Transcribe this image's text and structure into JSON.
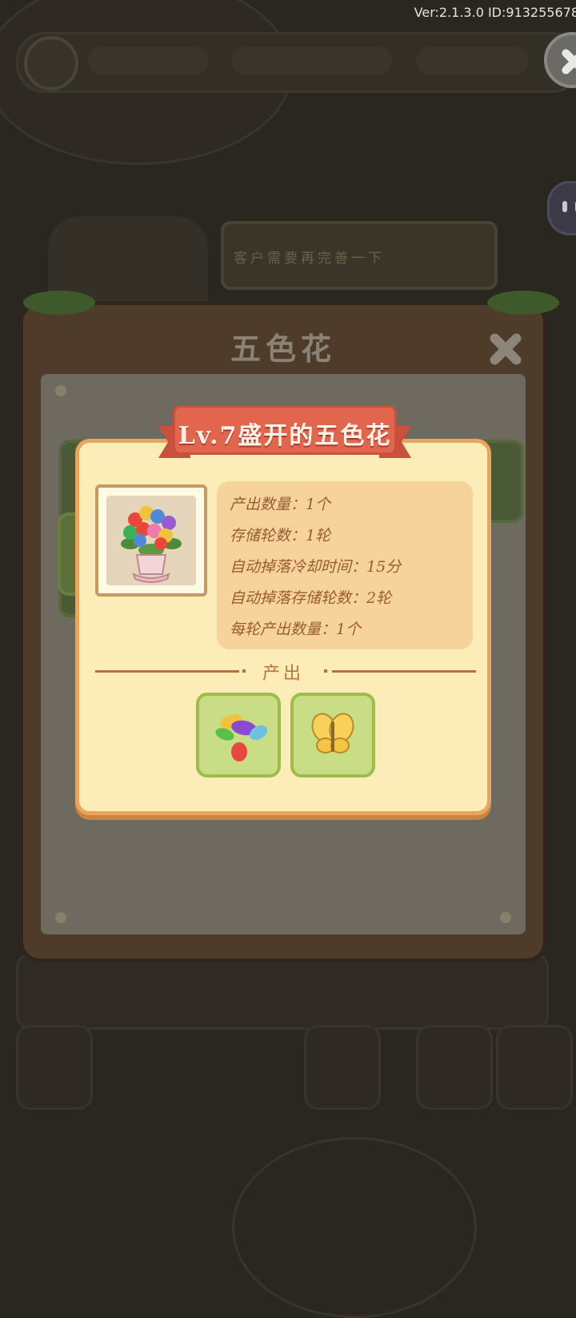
{
  "status": {
    "version": "Ver:2.1.3.0 ID:913255678"
  },
  "background": {
    "speech_text": "客户需要再完善一下"
  },
  "panel": {
    "title": "五色花"
  },
  "detail": {
    "banner": "Lv.7盛开的五色花",
    "stats": [
      {
        "label": "产出数量",
        "value": "1个"
      },
      {
        "label": "存储轮数",
        "value": "1轮"
      },
      {
        "label": "自动掉落冷却时间",
        "value": "15分"
      },
      {
        "label": "自动掉落存储轮数",
        "value": "2轮"
      },
      {
        "label": "每轮产出数量",
        "value": "1个"
      }
    ],
    "stat_lines": [
      "产出数量：1个",
      "存储轮数：1轮",
      "自动掉落冷却时间：15分",
      "自动掉落存储轮数：2轮",
      "每轮产出数量：1个"
    ],
    "output_label": "产出",
    "outputs": [
      {
        "icon": "petals-icon"
      },
      {
        "icon": "butterfly-icon"
      }
    ]
  },
  "seed_bag": {
    "badge": "!"
  },
  "colors": {
    "card_bg": "#fbecb8",
    "card_border": "#e8a55d",
    "banner_red": "#e2664e",
    "stat_text": "#9a5b33",
    "slot_green": "#c9dc86"
  }
}
